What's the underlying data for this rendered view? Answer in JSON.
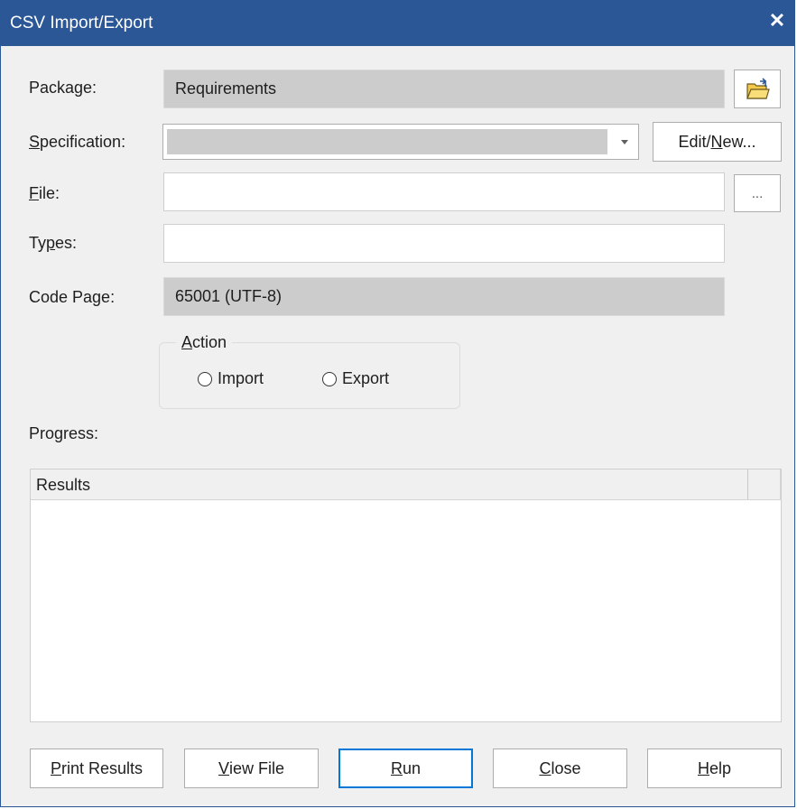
{
  "window": {
    "title": "CSV Import/Export",
    "close_glyph": "✕"
  },
  "form": {
    "package": {
      "label": "Package:",
      "value": "Requirements"
    },
    "specification": {
      "label_pre": "",
      "label_mn": "S",
      "label_post": "pecification:",
      "value": "",
      "edit_btn_pre": "Edit/",
      "edit_btn_mn": "N",
      "edit_btn_post": "ew..."
    },
    "file": {
      "label_mn": "F",
      "label_post": "ile:",
      "value": "",
      "browse_btn": "..."
    },
    "types": {
      "label_pre": "Ty",
      "label_mn": "p",
      "label_post": "es:",
      "value": ""
    },
    "code_page": {
      "label": "Code Page:",
      "value": "65001 (UTF-8)"
    }
  },
  "action": {
    "legend_mn": "A",
    "legend_post": "ction",
    "import_label": "Import",
    "export_label": "Export",
    "import_checked": false,
    "export_checked": false
  },
  "progress": {
    "label": "Progress:"
  },
  "results": {
    "column_header": "Results",
    "rows": []
  },
  "buttons": {
    "print_mn": "P",
    "print_post": "rint Results",
    "view_mn": "V",
    "view_post": "iew File",
    "run_mn": "R",
    "run_post": "un",
    "close_mn": "C",
    "close_post": "lose",
    "help_mn": "H",
    "help_post": "elp"
  },
  "icons": {
    "folder": "folder-open-icon",
    "dropdown": "chevron-down-icon",
    "close": "close-icon"
  },
  "colors": {
    "titlebar": "#2b5797",
    "default_button_border": "#0078d7",
    "readonly_field": "#cccccc"
  }
}
